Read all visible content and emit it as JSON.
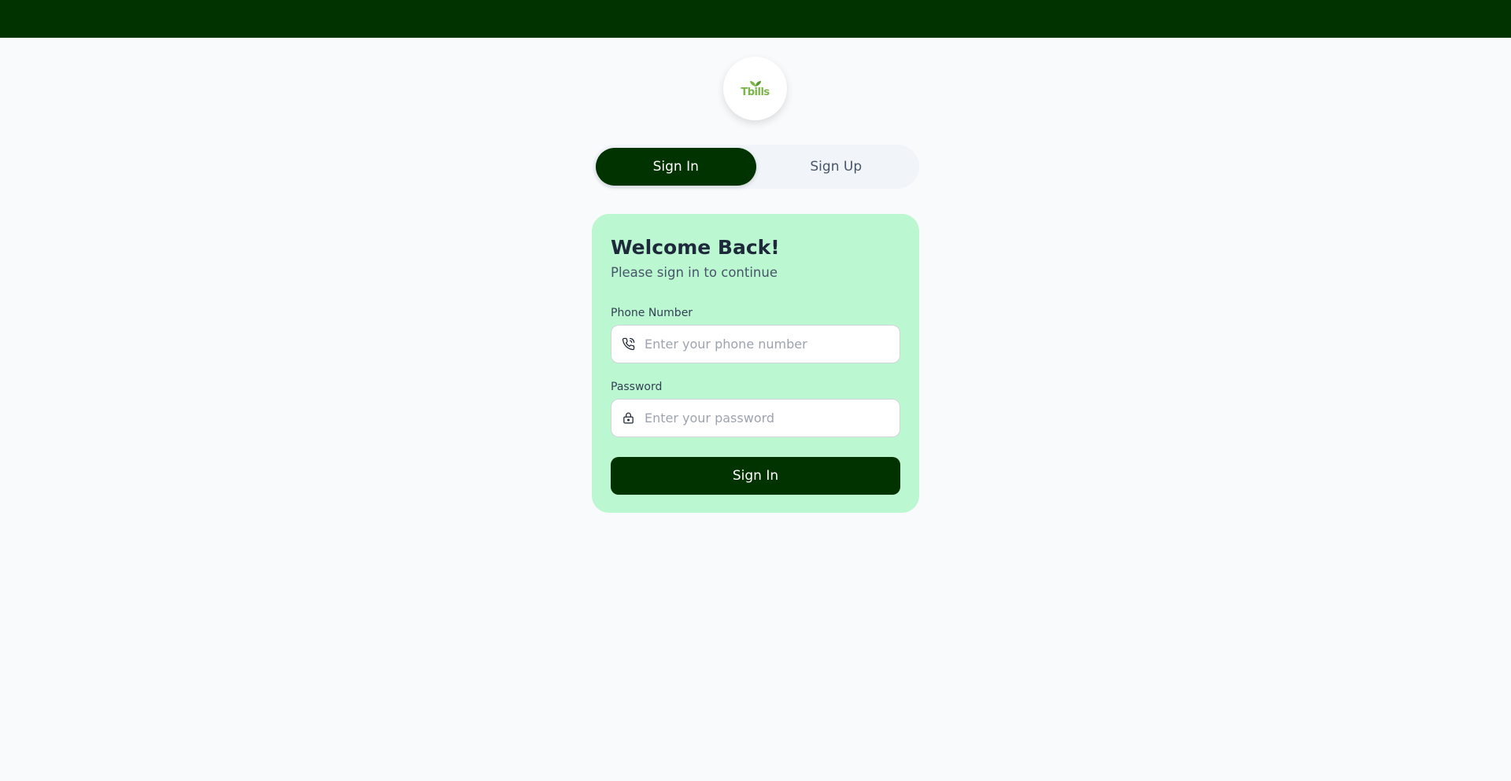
{
  "logo": {
    "text": "Tbills",
    "icon": "logo-leaf-icon",
    "color": "#7ab648"
  },
  "tabs": [
    {
      "label": "Sign In",
      "active": true
    },
    {
      "label": "Sign Up",
      "active": false
    }
  ],
  "form": {
    "title": "Welcome Back!",
    "subtitle": "Please sign in to continue",
    "phone": {
      "label": "Phone Number",
      "placeholder": "Enter your phone number",
      "value": "",
      "icon": "phone-icon"
    },
    "password": {
      "label": "Password",
      "placeholder": "Enter your password",
      "value": "",
      "icon": "lock-icon"
    },
    "submit_label": "Sign In"
  },
  "colors": {
    "brand_dark": "#003300",
    "card_bg": "#bbf7d0",
    "page_bg": "#f8fafc"
  }
}
